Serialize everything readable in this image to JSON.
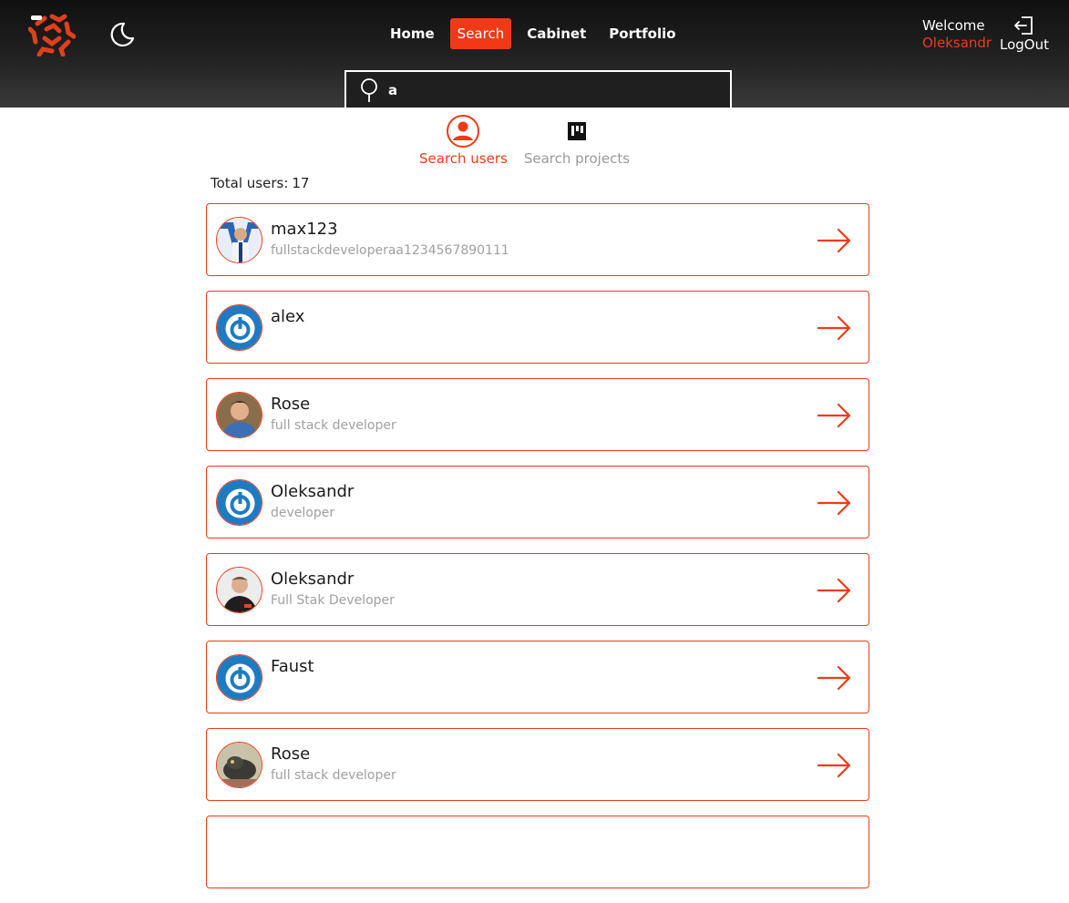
{
  "nav": {
    "items": [
      {
        "label": "Home",
        "active": false
      },
      {
        "label": "Search",
        "active": true
      },
      {
        "label": "Cabinet",
        "active": false
      },
      {
        "label": "Portfolio",
        "active": false
      }
    ]
  },
  "welcome": {
    "label": "Welcome",
    "user": "Oleksandr"
  },
  "logout": {
    "label": "LogOut"
  },
  "search": {
    "value": "a",
    "icon": "search-icon"
  },
  "tabs": {
    "users": {
      "label": "Search users",
      "icon": "user-icon"
    },
    "projects": {
      "label": "Search projects",
      "icon": "board-icon"
    }
  },
  "total": {
    "label": "Total users:",
    "count": "17"
  },
  "users": [
    {
      "name": "max123",
      "role": "fullstackdeveloperaa1234567890111",
      "avatar": "photo"
    },
    {
      "name": "alex",
      "role": "",
      "avatar": "power-icon"
    },
    {
      "name": "Rose",
      "role": "full stack developer",
      "avatar": "photo"
    },
    {
      "name": "Oleksandr",
      "role": "developer",
      "avatar": "power-icon"
    },
    {
      "name": "Oleksandr",
      "role": "Full Stak Developer",
      "avatar": "photo"
    },
    {
      "name": "Faust",
      "role": "",
      "avatar": "power-icon"
    },
    {
      "name": "Rose",
      "role": "full stack developer",
      "avatar": "photo"
    }
  ],
  "colors": {
    "accent": "#f03a17",
    "header": "#1c1c1c",
    "muted": "#a0a0a0"
  }
}
